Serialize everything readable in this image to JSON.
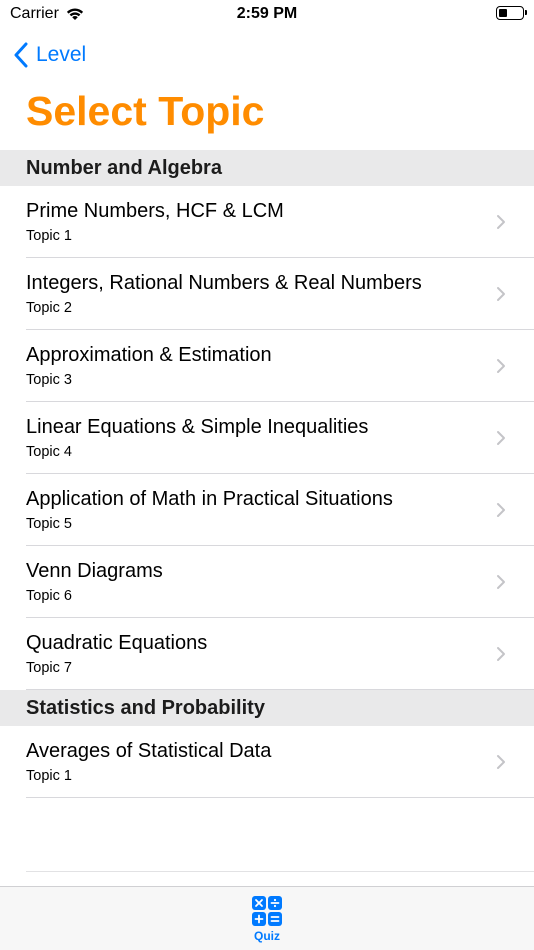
{
  "status_bar": {
    "carrier": "Carrier",
    "time": "2:59 PM"
  },
  "nav": {
    "back_label": "Level"
  },
  "page_title": "Select Topic",
  "sections": [
    {
      "header": "Number and Algebra",
      "rows": [
        {
          "title": "Prime Numbers, HCF & LCM",
          "subtitle": "Topic 1"
        },
        {
          "title": "Integers, Rational Numbers & Real Numbers",
          "subtitle": "Topic 2"
        },
        {
          "title": "Approximation & Estimation",
          "subtitle": "Topic 3"
        },
        {
          "title": "Linear Equations & Simple Inequalities",
          "subtitle": "Topic 4"
        },
        {
          "title": "Application of Math in Practical Situations",
          "subtitle": "Topic 5"
        },
        {
          "title": "Venn Diagrams",
          "subtitle": "Topic 6"
        },
        {
          "title": "Quadratic Equations",
          "subtitle": "Topic 7"
        }
      ]
    },
    {
      "header": "Statistics and Probability",
      "rows": [
        {
          "title": "Averages of Statistical Data",
          "subtitle": "Topic 1"
        }
      ]
    }
  ],
  "tab_bar": {
    "quiz_label": "Quiz",
    "quiz_icon": "calculator-icon"
  },
  "colors": {
    "accent": "#007aff",
    "title": "#ff8c00",
    "section_bg": "#e9e9ea"
  }
}
